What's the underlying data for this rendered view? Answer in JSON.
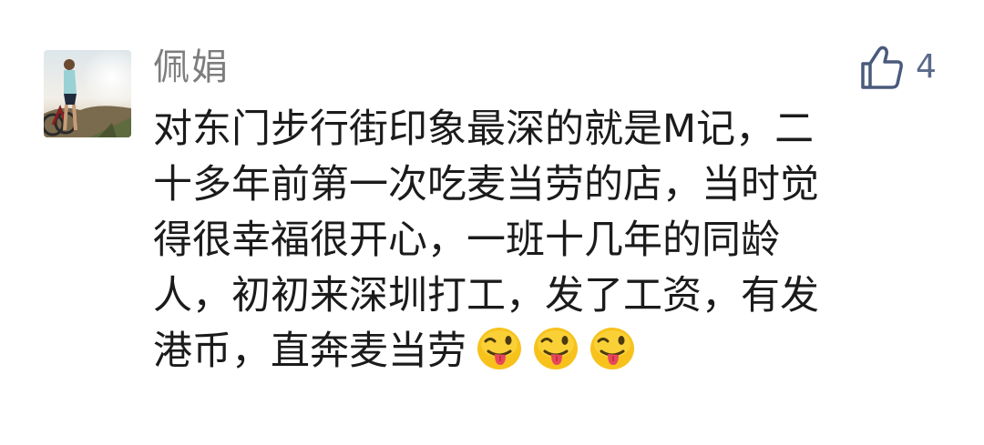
{
  "comment": {
    "author": "佩娟",
    "like_count": "4",
    "body_lines": [
      "对东门步行街印象最深的就是M记，二",
      "十多年前第一次吃麦当劳的店，当时觉",
      "得很幸福很开心，一班十几年的同龄",
      "人，初初来深圳打工，发了工资，有发",
      "港币，直奔麦当劳"
    ],
    "emojis": [
      "winking-tongue-emoji",
      "winking-tongue-emoji",
      "winking-tongue-emoji"
    ],
    "colors": {
      "author": "#7d7d7d",
      "body": "#1b1b1b",
      "like": "#5a6a8a",
      "emoji_face": "#f7c21c"
    }
  }
}
